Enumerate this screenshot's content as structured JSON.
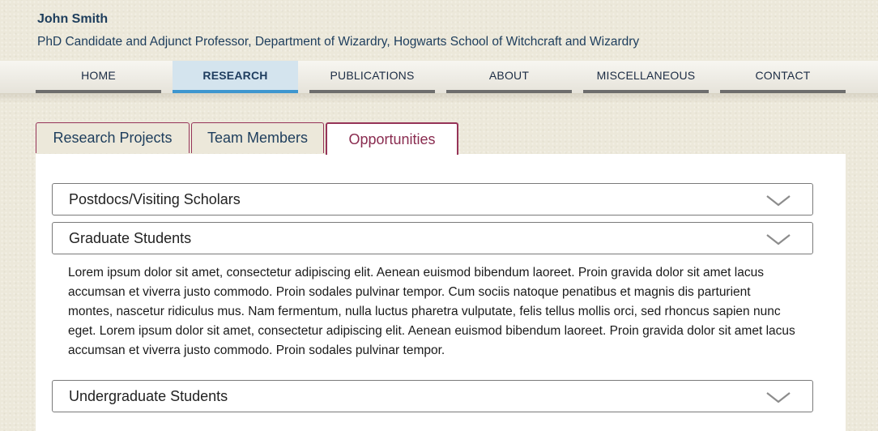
{
  "header": {
    "name": "John Smith",
    "subtitle": "PhD Candidate and Adjunct Professor, Department of Wizardry, Hogwarts School of Witchcraft and Wizardry"
  },
  "nav": {
    "items": [
      {
        "label": "HOME",
        "active": false
      },
      {
        "label": "RESEARCH",
        "active": true
      },
      {
        "label": "PUBLICATIONS",
        "active": false
      },
      {
        "label": "ABOUT",
        "active": false
      },
      {
        "label": "MISCELLANEOUS",
        "active": false
      },
      {
        "label": "CONTACT",
        "active": false
      }
    ],
    "active_color": "#3e96cf",
    "underline_color": "#6d6d6d"
  },
  "tabs": {
    "items": [
      {
        "label": "Research Projects",
        "active": false
      },
      {
        "label": "Team Members",
        "active": false
      },
      {
        "label": "Opportunities",
        "active": true
      }
    ],
    "accent_color": "#963458"
  },
  "accordion": {
    "sections": [
      {
        "title": "Postdocs/Visiting Scholars",
        "expanded": false,
        "icon": "chevron-down-icon"
      },
      {
        "title": "Graduate Students",
        "expanded": true,
        "icon": "chevron-down-icon"
      },
      {
        "title": "Undergraduate Students",
        "expanded": false,
        "icon": "chevron-down-icon"
      }
    ],
    "expanded_body": "Lorem ipsum dolor sit amet, consectetur adipiscing elit. Aenean euismod bibendum laoreet. Proin gravida dolor sit amet lacus accumsan et viverra justo commodo. Proin sodales pulvinar tempor. Cum sociis natoque penatibus et magnis dis parturient montes, nascetur ridiculus mus. Nam fermentum, nulla luctus pharetra vulputate, felis tellus mollis orci, sed rhoncus sapien nunc eget. Lorem ipsum dolor sit amet, consectetur adipiscing elit. Aenean euismod bibendum laoreet. Proin gravida dolor sit amet lacus accumsan et viverra justo commodo. Proin sodales pulvinar tempor."
  }
}
